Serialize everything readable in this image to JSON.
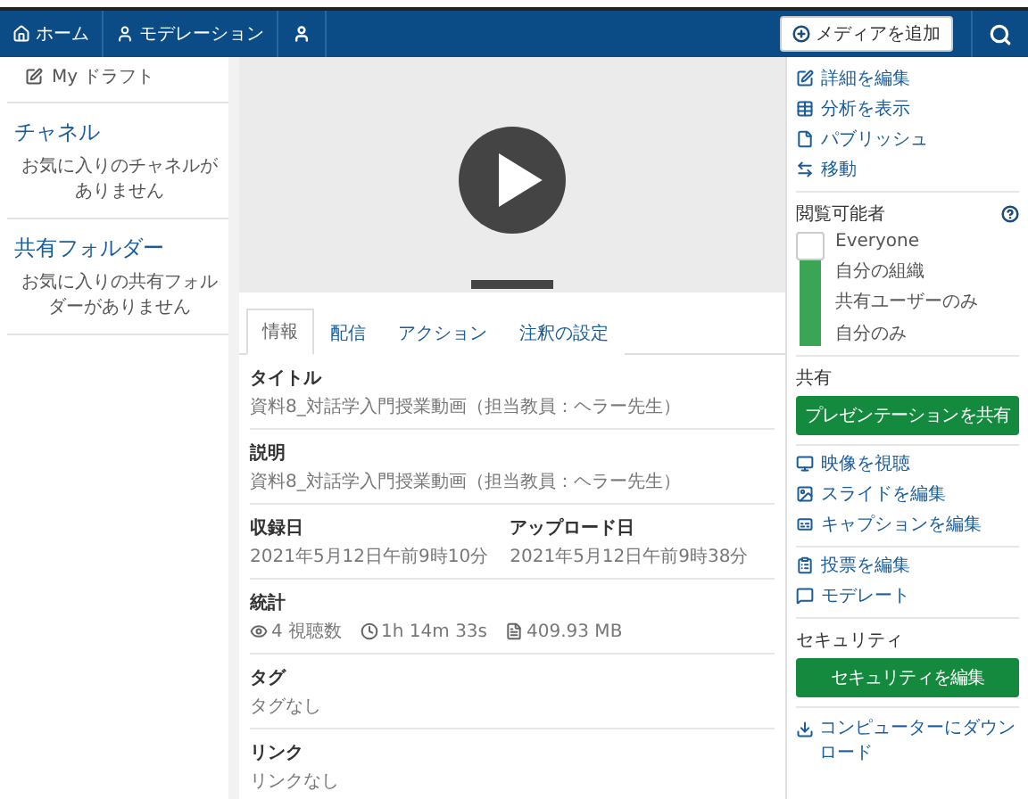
{
  "nav": {
    "items": [
      "ホーム",
      "モデレーション"
    ],
    "add_media": "メディアを追加"
  },
  "sidebar": {
    "draft": "My ドラフト",
    "sections": [
      {
        "title": "チャネル",
        "note": "お気に入りのチャネルがありません"
      },
      {
        "title": "共有フォルダー",
        "note": "お気に入りの共有フォルダーがありません"
      }
    ]
  },
  "tabs": [
    {
      "label": "情報",
      "selected": true
    },
    {
      "label": "配信",
      "selected": false
    },
    {
      "label": "アクション",
      "selected": false
    },
    {
      "label": "注釈の設定",
      "selected": false
    }
  ],
  "fields": [
    {
      "kind": "text",
      "label": "タイトル",
      "value": "資料8_対話学入門授業動画（担当教員：ヘラー先生）"
    },
    {
      "kind": "text",
      "label": "説明",
      "value": "資料8_対話学入門授業動画（担当教員：ヘラー先生）"
    },
    {
      "kind": "pair",
      "items": [
        {
          "label": "収録日",
          "value": "2021年5月12日午前9時10分"
        },
        {
          "label": "アップロード日",
          "value": "2021年5月12日午前9時38分"
        }
      ]
    },
    {
      "kind": "stats",
      "label": "統計",
      "items": [
        "4 視聴数",
        "1h 14m 33s",
        "409.93 MB"
      ]
    },
    {
      "kind": "text",
      "label": "タグ",
      "value": "タグなし"
    },
    {
      "kind": "text",
      "label": "リンク",
      "value": "リンクなし"
    }
  ],
  "right": {
    "links": [
      "詳細を編集",
      "分析を表示",
      "パブリッシュ",
      "移動"
    ],
    "visibility": {
      "title": "閲覧可能者",
      "level": 1,
      "options": [
        "Everyone",
        "自分の組織",
        "共有ユーザーのみ",
        "自分のみ"
      ]
    },
    "share": {
      "title": "共有",
      "button": "プレゼンテーションを共有"
    },
    "edit_links": [
      "映像を視聴",
      "スライドを編集",
      "キャプションを編集"
    ],
    "more_links": [
      "投票を編集",
      "モデレート"
    ],
    "security": {
      "title": "セキュリティ",
      "button": "セキュリティを編集"
    },
    "download": "コンピューターにダウンロード"
  }
}
